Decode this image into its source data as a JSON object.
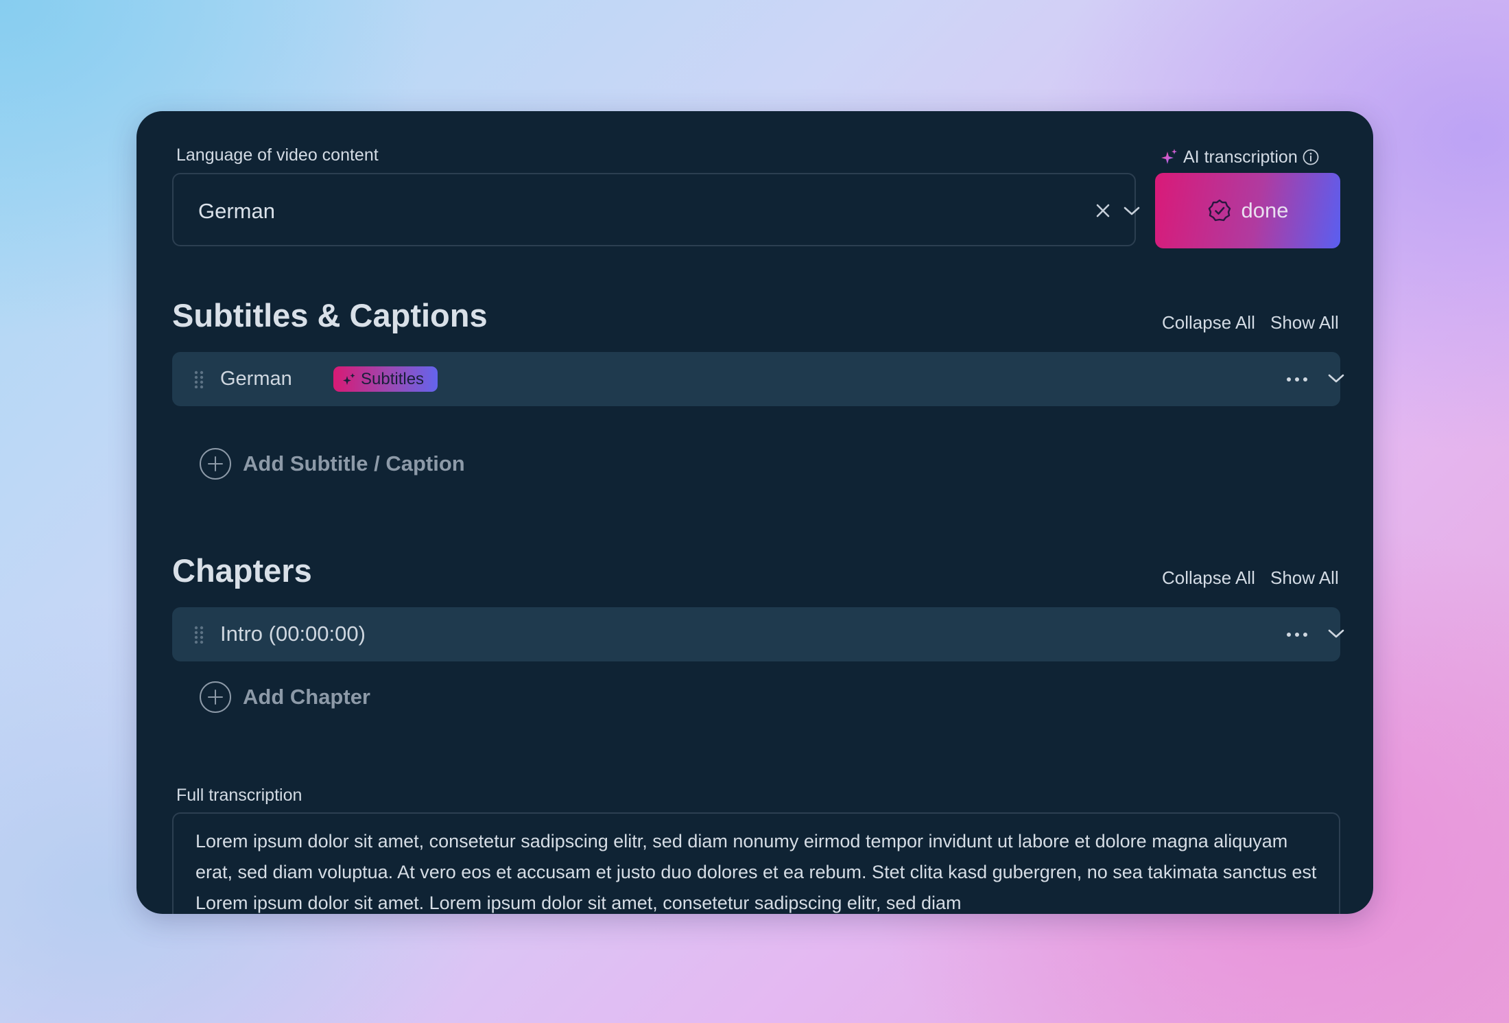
{
  "language": {
    "label": "Language of video content",
    "value": "German",
    "clear_icon": "close-icon",
    "chevron_icon": "chevron-down-icon"
  },
  "ai_transcription": {
    "label": "AI transcription",
    "sparkle_icon": "sparkle-icon",
    "info_icon": "info-icon",
    "button_label": "done",
    "button_icon": "check-badge-icon"
  },
  "subtitles": {
    "title": "Subtitles & Captions",
    "collapse_all": "Collapse All",
    "show_all": "Show All",
    "items": [
      {
        "label": "German",
        "badge": "Subtitles"
      }
    ],
    "add_label": "Add Subtitle / Caption"
  },
  "chapters": {
    "title": "Chapters",
    "collapse_all": "Collapse All",
    "show_all": "Show All",
    "items": [
      {
        "label": "Intro (00:00:00)"
      }
    ],
    "add_label": "Add Chapter"
  },
  "transcription": {
    "label": "Full transcription",
    "text": "Lorem ipsum dolor sit amet, consetetur sadipscing elitr, sed diam nonumy eirmod tempor invidunt ut labore et dolore magna aliquyam erat, sed diam voluptua. At vero eos et accusam et justo duo dolores et ea rebum. Stet clita kasd gubergren, no sea takimata sanctus est Lorem ipsum dolor sit amet. Lorem ipsum dolor sit amet, consetetur sadipscing elitr, sed diam"
  },
  "colors": {
    "card_background": "#0f2334",
    "row_background": "#1f3a4e",
    "gradient_start": "#d91a78",
    "gradient_end": "#5a5ff0"
  }
}
